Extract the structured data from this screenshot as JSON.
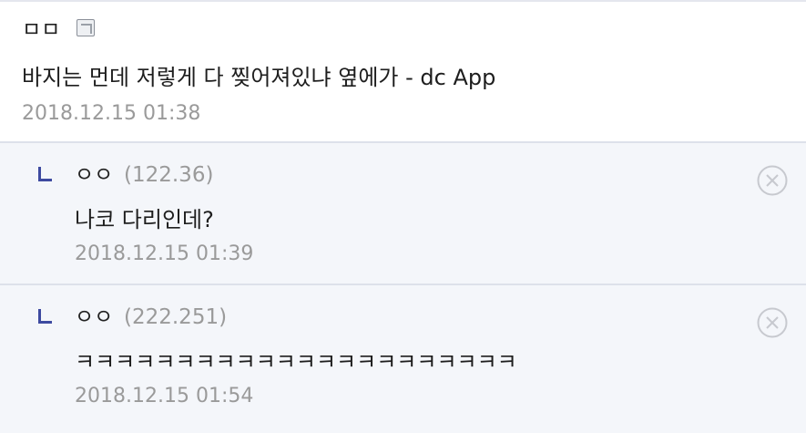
{
  "comment": {
    "author": "ㅁㅁ",
    "author_icon": "gallog-icon",
    "text": "바지는 먼데 저렇게 다 찢어져있냐 옆에가 - dc App",
    "date": "2018.12.15 01:38"
  },
  "replies": [
    {
      "author": "ㅇㅇ",
      "ip": "(122.36)",
      "text": "나코 다리인데?",
      "date": "2018.12.15 01:39",
      "delete_icon": "close-circle-icon"
    },
    {
      "author": "ㅇㅇ",
      "ip": "(222.251)",
      "text": "ㅋㅋㅋㅋㅋㅋㅋㅋㅋㅋㅋㅋㅋㅋㅋㅋㅋㅋㅋㅋㅋㅋ",
      "date": "2018.12.15 01:54",
      "delete_icon": "close-circle-icon"
    }
  ],
  "colors": {
    "reply_marker": "#3d4aa0",
    "reply_background": "#f4f6fa",
    "meta_text": "#9a9a9a"
  }
}
